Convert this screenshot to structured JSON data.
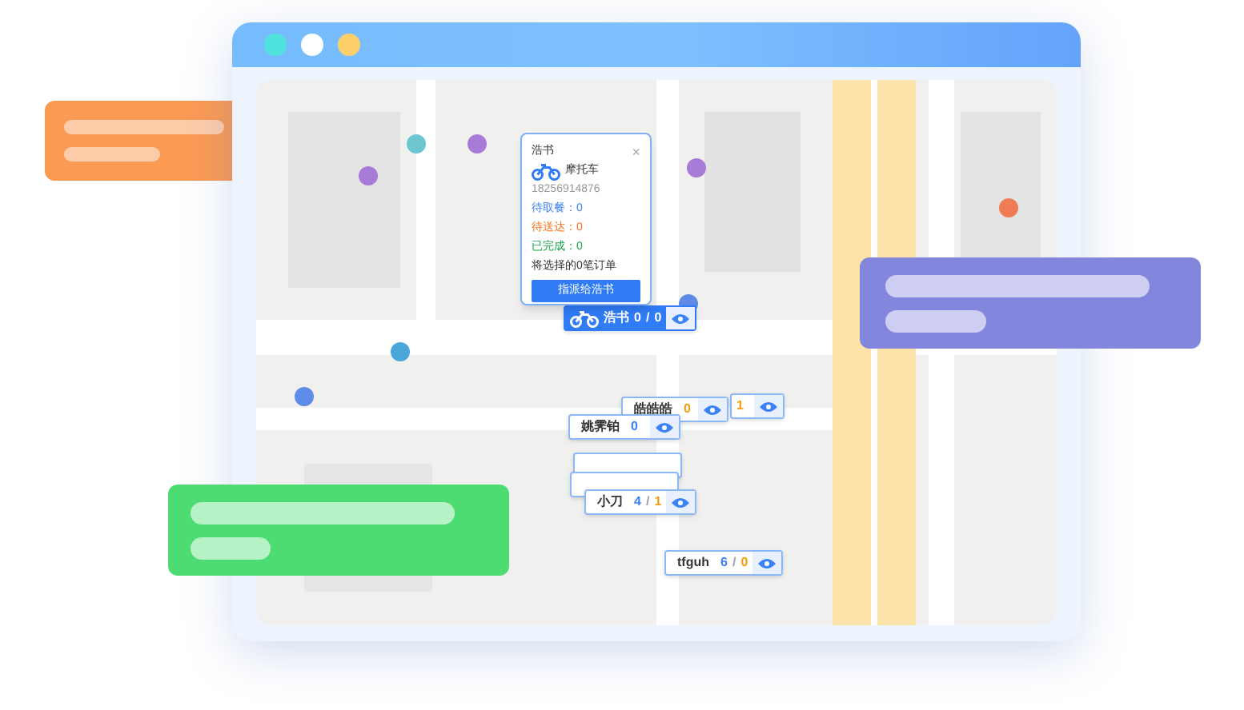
{
  "popup": {
    "name": "浩书",
    "vehicle": "摩托车",
    "phone": "18256914876",
    "close": "×",
    "stats": [
      {
        "kind": "pending",
        "text": "待取餐：0"
      },
      {
        "kind": "delivering",
        "text": "待送达：0"
      },
      {
        "kind": "done",
        "text": "已完成：0"
      }
    ],
    "summary": "将选择的0笔订单",
    "button": "指派给浩书"
  },
  "markers": [
    {
      "name": "浩书",
      "taken": "0",
      "separator": "/",
      "delivered": "0",
      "selected": true
    },
    {
      "delivered": "1",
      "selected": false
    },
    {
      "name": "皓皓皓",
      "delivered": "0",
      "selected": false
    },
    {
      "name": "姚霁铂",
      "taken": "0",
      "selected": false
    },
    {
      "name": "小刀",
      "taken": "4",
      "separator": "/",
      "delivered": "1",
      "selected": false
    },
    {
      "name": "tfguh",
      "taken": "6",
      "separator": "/",
      "delivered": "0",
      "selected": false
    }
  ]
}
